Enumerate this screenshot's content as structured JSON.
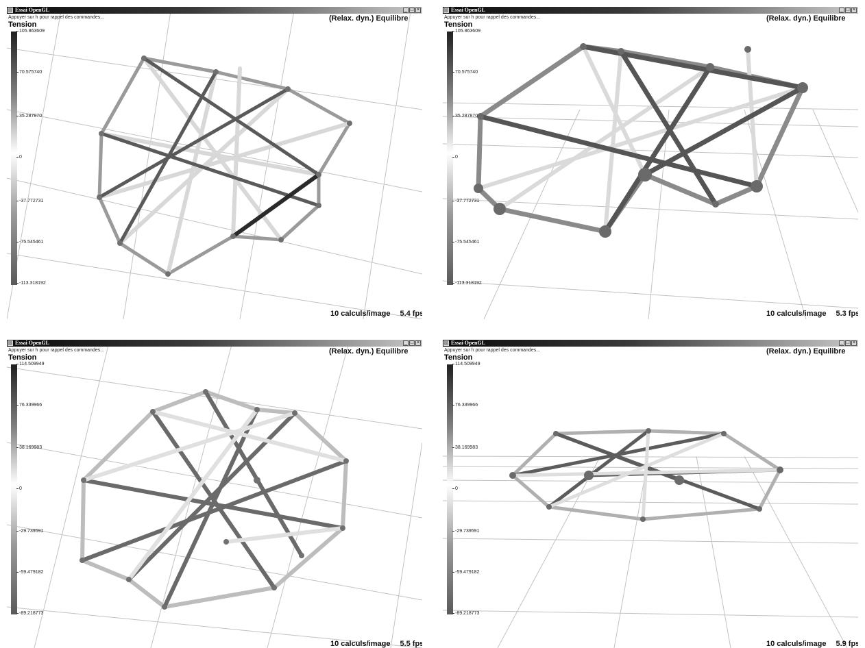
{
  "windows": [
    {
      "id": "top-left",
      "title": "Essai OpenGL",
      "hint": "Appuyer sur h pour rappel des commandes...",
      "status": "(Relax. dyn.) Equilibre",
      "legend_title": "Tension",
      "ticks": [
        "105.863609",
        "70.575740",
        "35.287870",
        "0",
        "-37.772731",
        "-75.545461",
        "-113.318192"
      ],
      "footer": {
        "calc": "10 calculs/image",
        "fps": "5.4 fps"
      }
    },
    {
      "id": "top-right",
      "title": "Essai OpenGL",
      "hint": "Appuyer sur h pour rappel des commandes...",
      "status": "(Relax. dyn.) Equilibre",
      "legend_title": "Tension",
      "ticks": [
        "105.863609",
        "70.575740",
        "35.287870",
        "0",
        "-37.772731",
        "-75.545461",
        "-113.318192"
      ],
      "footer": {
        "calc": "10 calculs/image",
        "fps": "5.3 fps"
      }
    },
    {
      "id": "bottom-left",
      "title": "Essai OpenGL",
      "hint": "Appuyer sur h pour rappel des commandes...",
      "status": "(Relax. dyn.) Equilibre",
      "legend_title": "Tension",
      "ticks": [
        "114.509949",
        "76.339966",
        "38.169983",
        "0",
        "-29.739591",
        "-59.479182",
        "-89.218773"
      ],
      "footer": {
        "calc": "10 calculs/image",
        "fps": "5.5 fps"
      }
    },
    {
      "id": "bottom-right",
      "title": "Essai OpenGL",
      "hint": "Appuyer sur h pour rappel des commandes...",
      "status": "(Relax. dyn.) Equilibre",
      "legend_title": "Tension",
      "ticks": [
        "114.509949",
        "76.339966",
        "38.169983",
        "0",
        "-29.739591",
        "-59.479182",
        "-89.218773"
      ],
      "footer": {
        "calc": "10 calculs/image",
        "fps": "5.9 fps"
      }
    }
  ],
  "icons": {
    "app": "app-icon",
    "minimize": "minimize-icon",
    "maximize": "maximize-icon",
    "close": "close-icon"
  },
  "colors": {
    "titlebar": "#0a0a0a",
    "grid": "#bdbdbd",
    "strut_dark": "#3a3a3a",
    "strut_light": "#dcdcdc",
    "node": "#6e6e6e"
  }
}
